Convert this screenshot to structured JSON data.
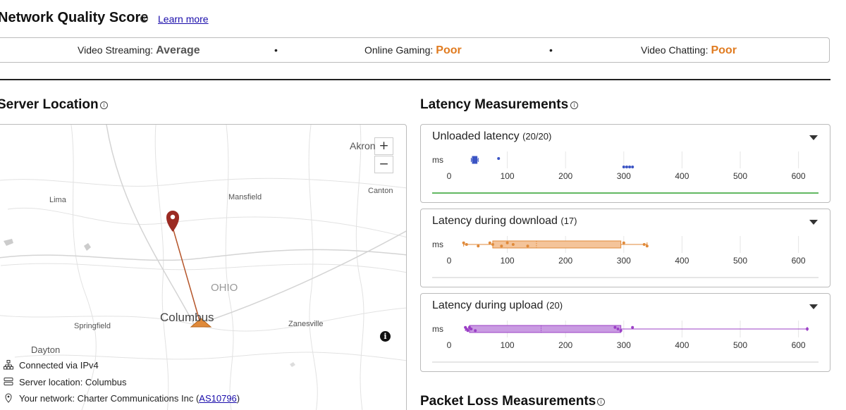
{
  "quality": {
    "title": "Network Quality Score",
    "info_icon": "info-icon",
    "learn_more": "Learn more",
    "items": [
      {
        "label": "Video Streaming:",
        "value": "Average"
      },
      {
        "label": "Online Gaming:",
        "value": "Poor"
      },
      {
        "label": "Video Chatting:",
        "value": "Poor"
      }
    ],
    "separator": "•"
  },
  "server": {
    "title": "Server Location",
    "map": {
      "zoom_in": "+",
      "zoom_out": "−",
      "labels": [
        "Akron",
        "Mansfield",
        "Canton",
        "Lima",
        "OHIO",
        "Columbus",
        "Springfield",
        "Zanesville",
        "Dayton"
      ],
      "info_button": "i"
    },
    "connection": "Connected via IPv4",
    "location": "Server location: Columbus",
    "network_prefix": "Your network: Charter Communications Inc (",
    "network_as": "AS10796",
    "network_suffix": ")"
  },
  "latency": {
    "title": "Latency Measurements",
    "unit": "ms",
    "ticks": [
      "0",
      "100",
      "200",
      "300",
      "400",
      "500",
      "600"
    ],
    "cards": [
      {
        "name": "Unloaded latency",
        "count": "(20/20)",
        "color": "#3b54c4",
        "line_color": "#2ea02e"
      },
      {
        "name": "Latency during download",
        "count": "(17)",
        "color": "#e08a3a",
        "line_color": "#cccccc"
      },
      {
        "name": "Latency during upload",
        "count": "(20)",
        "color": "#9b3fc6",
        "line_color": "#cccccc"
      }
    ]
  },
  "packet_loss": {
    "title": "Packet Loss Measurements"
  },
  "chart_data": [
    {
      "type": "box",
      "title": "Unloaded latency",
      "xlabel": "ms",
      "xlim": [
        0,
        620
      ],
      "min": 38,
      "q1": 40,
      "median": 43,
      "q3": 48,
      "max": 50,
      "outliers": [
        85,
        300,
        305,
        310,
        315
      ]
    },
    {
      "type": "box",
      "title": "Latency during download",
      "xlabel": "ms",
      "xlim": [
        0,
        620
      ],
      "min": 25,
      "q1": 75,
      "median": 150,
      "q3": 295,
      "max": 340,
      "outliers": [
        25,
        30,
        50,
        70,
        75,
        90,
        100,
        110,
        135,
        300,
        335,
        340
      ]
    },
    {
      "type": "box",
      "title": "Latency during upload",
      "xlabel": "ms",
      "xlim": [
        0,
        620
      ],
      "min": 28,
      "q1": 35,
      "median": 158,
      "q3": 295,
      "max": 615,
      "outliers": [
        28,
        30,
        32,
        35,
        38,
        45,
        285,
        290,
        295,
        315,
        615
      ]
    }
  ]
}
